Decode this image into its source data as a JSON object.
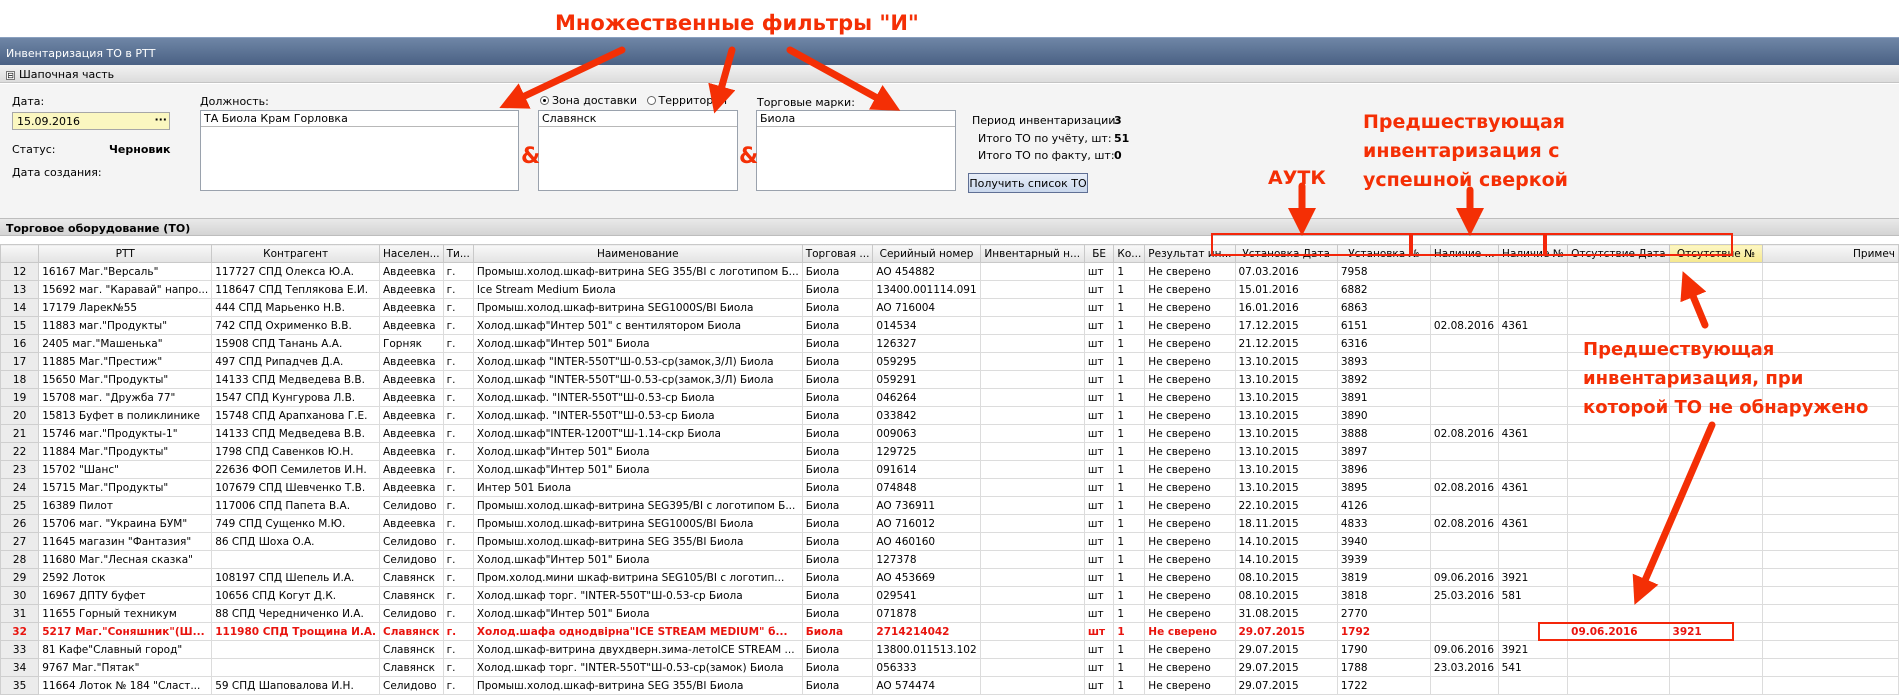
{
  "window": {
    "title": "Инвентаризация ТО в РТТ"
  },
  "section": {
    "toggle": "⊟",
    "title": "Шапочная часть"
  },
  "header": {
    "date_label": "Дата:",
    "date_value": "15.09.2016",
    "date_btn": "···",
    "status_label": "Статус:",
    "status_value": "Черновик",
    "created_label": "Дата создания:",
    "position_label": "Должность:",
    "position_value": "ТА Биола Крам Горловка",
    "radio_zone": "Зона доставки",
    "radio_territory": "Территория",
    "zone_value": "Славянск",
    "brands_label": "Торговые марки:",
    "brands_value": "Биола",
    "period_label": "Период инвентаризации:",
    "period_value": "3",
    "total_acc_label": "Итого ТО по учёту, шт:",
    "total_acc_value": "51",
    "total_fact_label": "Итого ТО по факту, шт:",
    "total_fact_value": "0",
    "get_list_btn": "Получить список ТО"
  },
  "grid": {
    "title": "Торговое оборудование (ТО)",
    "columns": [
      "",
      "РТТ",
      "Контрагент",
      "Населен...",
      "Ти...",
      "Наименование",
      "Торговая ...",
      "Серийный номер",
      "Инвентарный н...",
      "БЕ",
      "Ко...",
      "Результат ин...",
      "Установка Дата",
      "Установка №",
      "Наличие ...",
      "Наличие №",
      "Отсутствие Дата",
      "Отсутствие №",
      "Примеч"
    ],
    "rows": [
      [
        "12",
        "16167 Маг.\"Версаль\"",
        "117727 СПД Олекса Ю.А.",
        "Авдеевка",
        "г.",
        "Промыш.холод.шкаф-витрина SEG 355/BI с логотипом Б...",
        "Биола",
        "AO 454882",
        "",
        "шт",
        "1",
        "Не сверено",
        "07.03.2016",
        "7958",
        "",
        "",
        "",
        "",
        ""
      ],
      [
        "13",
        "15692 маг. \"Каравай\" напро...",
        "118647 СПД Теплякова Е.И.",
        "Авдеевка",
        "г.",
        "Ice Stream Medium Биола",
        "Биола",
        "13400.001114.091",
        "",
        "шт",
        "1",
        "Не сверено",
        "15.01.2016",
        "6882",
        "",
        "",
        "",
        "",
        ""
      ],
      [
        "14",
        "17179 Ларек№55",
        "444 СПД Марьенко Н.В.",
        "Авдеевка",
        "г.",
        "Промыш.холод.шкаф-витрина SEG1000S/BI Биола",
        "Биола",
        "AO 716004",
        "",
        "шт",
        "1",
        "Не сверено",
        "16.01.2016",
        "6863",
        "",
        "",
        "",
        "",
        ""
      ],
      [
        "15",
        "11883 маг.\"Продукты\"",
        "742 СПД Охрименко В.В.",
        "Авдеевка",
        "г.",
        "Холод.шкаф\"Интер 501\" с вентилятором Биола",
        "Биола",
        "014534",
        "",
        "шт",
        "1",
        "Не сверено",
        "17.12.2015",
        "6151",
        "02.08.2016",
        "4361",
        "",
        "",
        ""
      ],
      [
        "16",
        "2405 маг.\"Машенька\"",
        "15908 СПД Танань А.А.",
        "Горняк",
        "г.",
        "Холод.шкаф\"Интер 501\" Биола",
        "Биола",
        "126327",
        "",
        "шт",
        "1",
        "Не сверено",
        "21.12.2015",
        "6316",
        "",
        "",
        "",
        "",
        ""
      ],
      [
        "17",
        "11885 Маг.\"Престиж\"",
        "497 СПД Рипадчев Д.А.",
        "Авдеевка",
        "г.",
        "Холод.шкаф \"INTER-550T\"Ш-0.53-ср(замок,3/Л) Биола",
        "Биола",
        "059295",
        "",
        "шт",
        "1",
        "Не сверено",
        "13.10.2015",
        "3893",
        "",
        "",
        "",
        "",
        ""
      ],
      [
        "18",
        "15650 Маг.\"Продукты\"",
        "14133 СПД Медведева В.В.",
        "Авдеевка",
        "г.",
        "Холод.шкаф \"INTER-550T\"Ш-0.53-ср(замок,3/Л) Биола",
        "Биола",
        "059291",
        "",
        "шт",
        "1",
        "Не сверено",
        "13.10.2015",
        "3892",
        "",
        "",
        "",
        "",
        ""
      ],
      [
        "19",
        "15708 маг. \"Дружба 77\"",
        "1547 СПД Кунгурова Л.В.",
        "Авдеевка",
        "г.",
        "Холод.шкаф. \"INTER-550T\"Ш-0.53-ср Биола",
        "Биола",
        "046264",
        "",
        "шт",
        "1",
        "Не сверено",
        "13.10.2015",
        "3891",
        "",
        "",
        "",
        "",
        ""
      ],
      [
        "20",
        "15813 Буфет в поликлинике",
        "15748 СПД Арапханова Г.Е.",
        "Авдеевка",
        "г.",
        "Холод.шкаф. \"INTER-550T\"Ш-0.53-ср Биола",
        "Биола",
        "033842",
        "",
        "шт",
        "1",
        "Не сверено",
        "13.10.2015",
        "3890",
        "",
        "",
        "",
        "",
        ""
      ],
      [
        "21",
        "15746 маг.\"Продукты-1\"",
        "14133 СПД Медведева В.В.",
        "Авдеевка",
        "г.",
        "Холод.шкаф\"INTER-1200T\"Ш-1.14-скр Биола",
        "Биола",
        "009063",
        "",
        "шт",
        "1",
        "Не сверено",
        "13.10.2015",
        "3888",
        "02.08.2016",
        "4361",
        "",
        "",
        ""
      ],
      [
        "22",
        "11884 Маг.\"Продукты\"",
        "1798 СПД Савенков Ю.Н.",
        "Авдеевка",
        "г.",
        "Холод.шкаф\"Интер 501\" Биола",
        "Биола",
        "129725",
        "",
        "шт",
        "1",
        "Не сверено",
        "13.10.2015",
        "3897",
        "",
        "",
        "",
        "",
        ""
      ],
      [
        "23",
        "15702 \"Шанс\"",
        "22636 ФОП Семилетов И.Н.",
        "Авдеевка",
        "г.",
        "Холод.шкаф\"Интер 501\" Биола",
        "Биола",
        "091614",
        "",
        "шт",
        "1",
        "Не сверено",
        "13.10.2015",
        "3896",
        "",
        "",
        "",
        "",
        ""
      ],
      [
        "24",
        "15715 Маг.\"Продукты\"",
        "107679 СПД Шевченко Т.В.",
        "Авдеевка",
        "г.",
        "Интер 501 Биола",
        "Биола",
        "074848",
        "",
        "шт",
        "1",
        "Не сверено",
        "13.10.2015",
        "3895",
        "02.08.2016",
        "4361",
        "",
        "",
        ""
      ],
      [
        "25",
        "16389 Пилот",
        "117006 СПД Папета В.А.",
        "Селидово",
        "г.",
        "Промыш.холод.шкаф-витрина SEG395/BI с логотипом Б...",
        "Биола",
        "AO 736911",
        "",
        "шт",
        "1",
        "Не сверено",
        "22.10.2015",
        "4126",
        "",
        "",
        "",
        "",
        ""
      ],
      [
        "26",
        "15706 маг. \"Украина БУМ\"",
        "749 СПД Сущенко М.Ю.",
        "Авдеевка",
        "г.",
        "Промыш.холод.шкаф-витрина SEG1000S/BI Биола",
        "Биола",
        "AO 716012",
        "",
        "шт",
        "1",
        "Не сверено",
        "18.11.2015",
        "4833",
        "02.08.2016",
        "4361",
        "",
        "",
        ""
      ],
      [
        "27",
        "11645 магазин \"Фантазия\"",
        "86 СПД Шоха О.А.",
        "Селидово",
        "г.",
        "Промыш.холод.шкаф-витрина SEG 355/BI Биола",
        "Биола",
        "AO 460160",
        "",
        "шт",
        "1",
        "Не сверено",
        "14.10.2015",
        "3940",
        "",
        "",
        "",
        "",
        ""
      ],
      [
        "28",
        "11680 Маг.\"Лесная сказка\"",
        "",
        "Селидово",
        "г.",
        "Холод.шкаф\"Интер 501\" Биола",
        "Биола",
        "127378",
        "",
        "шт",
        "1",
        "Не сверено",
        "14.10.2015",
        "3939",
        "",
        "",
        "",
        "",
        ""
      ],
      [
        "29",
        "2592 Лоток",
        "108197 СПД Шепель И.А.",
        "Славянск",
        "г.",
        "Пром.холод.мини шкаф-витрина SEG105/BI с логотип...",
        "Биола",
        "AO 453669",
        "",
        "шт",
        "1",
        "Не сверено",
        "08.10.2015",
        "3819",
        "09.06.2016",
        "3921",
        "",
        "",
        ""
      ],
      [
        "30",
        "16967 ДПТУ буфет",
        "10656 СПД Когут Д.К.",
        "Славянск",
        "г.",
        "Холод.шкаф торг. \"INTER-550T\"Ш-0.53-ср Биола",
        "Биола",
        "029541",
        "",
        "шт",
        "1",
        "Не сверено",
        "08.10.2015",
        "3818",
        "25.03.2016",
        "581",
        "",
        "",
        ""
      ],
      [
        "31",
        "11655 Горный техникум",
        "88 СПД Чередниченко И.А.",
        "Селидово",
        "г.",
        "Холод.шкаф\"Интер 501\" Биола",
        "Биола",
        "071878",
        "",
        "шт",
        "1",
        "Не сверено",
        "31.08.2015",
        "2770",
        "",
        "",
        "",
        "",
        ""
      ],
      [
        "32",
        "5217 Маг.\"Соняшник\"(Ш...",
        "111980 СПД Трощина И.А.",
        "Славянск",
        "г.",
        "Холод.шафа однодвірна\"ICE STREAM MEDIUM\" б...",
        "Биола",
        "2714214042",
        "",
        "шт",
        "1",
        "Не сверено",
        "29.07.2015",
        "1792",
        "",
        "",
        "09.06.2016",
        "3921",
        ""
      ],
      [
        "33",
        "81 Кафе\"Славный город\"",
        "",
        "Славянск",
        "г.",
        "Холод.шкаф-витрина двухдверн.зима-летоICE STREAM ...",
        "Биола",
        "13800.011513.102",
        "",
        "шт",
        "1",
        "Не сверено",
        "29.07.2015",
        "1790",
        "09.06.2016",
        "3921",
        "",
        "",
        ""
      ],
      [
        "34",
        "9767 Маг.\"Пятак\"",
        "",
        "Славянск",
        "г.",
        "Холод.шкаф торг. \"INTER-550T\"Ш-0.53-ср(замок) Биола",
        "Биола",
        "056333",
        "",
        "шт",
        "1",
        "Не сверено",
        "29.07.2015",
        "1788",
        "23.03.2016",
        "541",
        "",
        "",
        ""
      ],
      [
        "35",
        "11664 Лоток № 184 \"Сласт...",
        "59 СПД Шаповалова И.Н.",
        "Селидово",
        "г.",
        "Промыш.холод.шкаф-витрина SEG 355/BI Биола",
        "Биола",
        "AO 574474",
        "",
        "шт",
        "1",
        "Не сверено",
        "29.07.2015",
        "1722",
        "",
        "",
        "",
        "",
        ""
      ]
    ],
    "highlight_row_index": 20
  },
  "annotations": {
    "filters": "Множественные фильтры \"И\"",
    "amp": "&",
    "autk": "АУТК",
    "prev_success": [
      "Предшествующая",
      "инвентаризация с",
      "успешной сверкой"
    ],
    "prev_missing": [
      "Предшествующая",
      "инвентаризация, при",
      "которой ТО не обнаружено"
    ]
  },
  "colors": {
    "accent_annotation": "#f42f05",
    "highlight_row": "#e8140e",
    "date_field": "#fbf7c0",
    "titlebar": "#5a7193"
  }
}
